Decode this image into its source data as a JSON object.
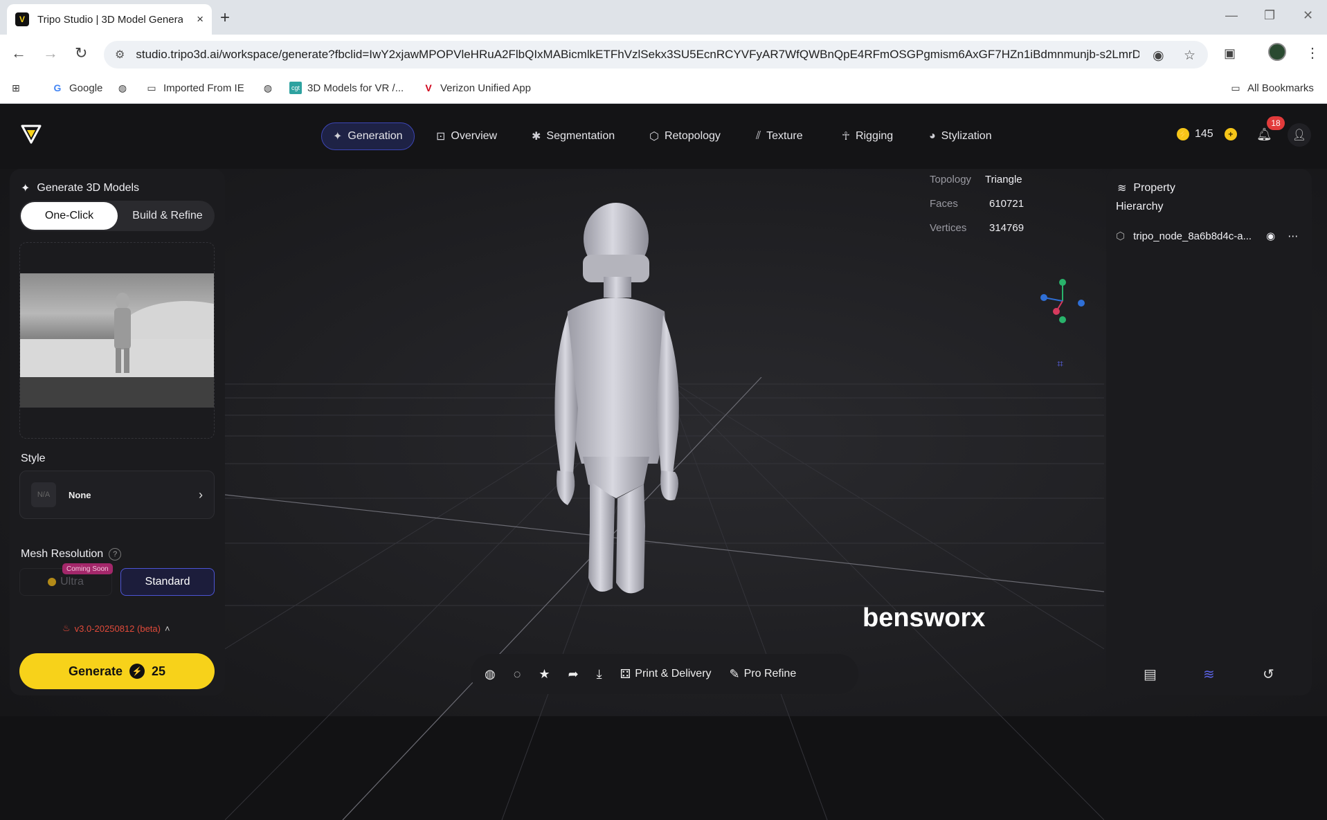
{
  "browser": {
    "tab_title": "Tripo Studio | 3D Model Genera",
    "tab_close": "×",
    "new_tab": "+",
    "url": "studio.tripo3d.ai/workspace/generate?fbclid=IwY2xjawMPOPVleHRuA2FlbQIxMABicmlkETFhVzlSekx3SU5EcnRCYVFyAR7WfQWBnQpE4RFmOSGPgmism6AxGF7HZn1iBdmnmunjb-s2LmrD...",
    "bookmarks": {
      "google": "Google",
      "imported": "Imported From IE",
      "vr": "3D Models for VR /...",
      "verizon": "Verizon Unified App",
      "all": "All Bookmarks"
    }
  },
  "app": {
    "nav": {
      "generation": "Generation",
      "overview": "Overview",
      "segmentation": "Segmentation",
      "retopology": "Retopology",
      "texture": "Texture",
      "rigging": "Rigging",
      "stylization": "Stylization"
    },
    "credits": "145",
    "notifications": "18",
    "left": {
      "title": "Generate 3D Models",
      "tab_oneclick": "One-Click",
      "tab_build": "Build & Refine",
      "style_label": "Style",
      "style_na": "N/A",
      "style_value": "None",
      "mesh_label": "Mesh Resolution",
      "ultra": "Ultra",
      "coming_soon": "Coming Soon",
      "standard": "Standard",
      "version": "v3.0-20250812 (beta)",
      "generate": "Generate",
      "cost": "25"
    },
    "right": {
      "property": "Property",
      "hierarchy": "Hierarchy",
      "node_name": "tripo_node_8a6b8d4c-a..."
    },
    "stats": {
      "topology_k": "Topology",
      "topology_v": "Triangle",
      "faces_k": "Faces",
      "faces_v": "610721",
      "vertices_k": "Vertices",
      "vertices_v": "314769"
    },
    "watermark": "bensworx",
    "viewbar": {
      "print": "Print & Delivery",
      "pro": "Pro Refine"
    }
  },
  "colors": {
    "accent": "#3d46b6",
    "brand_yellow": "#f7d21a",
    "badge_red": "#e23b3b"
  }
}
